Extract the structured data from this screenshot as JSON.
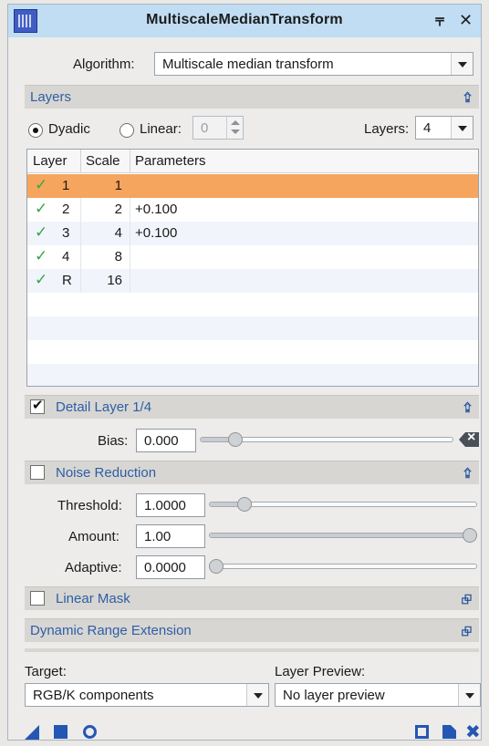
{
  "window": {
    "title": "MultiscaleMedianTransform",
    "pin_label": "‡",
    "close_label": "✕"
  },
  "algorithm": {
    "label": "Algorithm:",
    "value": "Multiscale median transform"
  },
  "layers_section": {
    "title": "Layers",
    "collapse_icon": "▲"
  },
  "layer_mode": {
    "dyadic_label": "Dyadic",
    "dyadic_selected": true,
    "linear_label": "Linear:",
    "linear_value": "0",
    "layers_label": "Layers:",
    "layers_value": "4"
  },
  "table": {
    "headers": [
      "Layer",
      "Scale",
      "Parameters"
    ],
    "rows": [
      {
        "enabled": true,
        "layer": "1",
        "scale": "1",
        "params": ""
      },
      {
        "enabled": true,
        "layer": "2",
        "scale": "2",
        "params": "+0.100"
      },
      {
        "enabled": true,
        "layer": "3",
        "scale": "4",
        "params": "+0.100"
      },
      {
        "enabled": true,
        "layer": "4",
        "scale": "8",
        "params": ""
      },
      {
        "enabled": true,
        "layer": "R",
        "scale": "16",
        "params": ""
      }
    ],
    "selected_row": 0
  },
  "detail_layer": {
    "title": "Detail Layer 1/4",
    "checked": true,
    "bias_label": "Bias:",
    "bias_value": "0.000",
    "bias_slider_fraction": 0.12
  },
  "noise_reduction": {
    "title": "Noise Reduction",
    "checked": false,
    "threshold_label": "Threshold:",
    "threshold_value": "1.0000",
    "threshold_fraction": 0.11,
    "amount_label": "Amount:",
    "amount_value": "1.00",
    "amount_fraction": 1.0,
    "adaptive_label": "Adaptive:",
    "adaptive_value": "0.0000",
    "adaptive_fraction": 0.0
  },
  "linear_mask": {
    "title": "Linear Mask",
    "checked": false
  },
  "dynamic_range": {
    "title": "Dynamic Range Extension"
  },
  "target": {
    "label": "Target:",
    "value": "RGB/K components"
  },
  "layer_preview": {
    "label": "Layer Preview:",
    "value": "No layer preview"
  },
  "colors": {
    "accent": "#2d5ea8",
    "selection": "#f6a55e",
    "check": "#39a547",
    "titlebar": "#c0ddf3"
  },
  "icons": [
    "new-instance-icon",
    "apply-global-icon",
    "real-time-preview-icon",
    "browse-docs-icon",
    "reset-icon",
    "expand-icon"
  ]
}
